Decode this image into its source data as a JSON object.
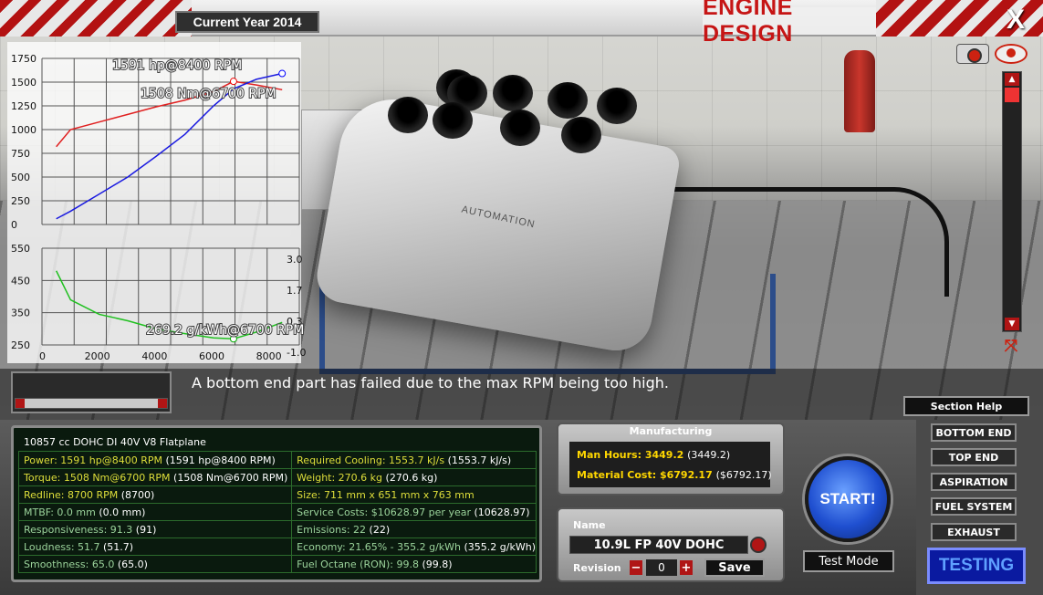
{
  "header": {
    "year_label": "Current Year 2014",
    "title": "ENGINE DESIGN",
    "close_label": "X"
  },
  "charts": {
    "power_torque": {
      "type": "line",
      "y_ticks": [
        "1750",
        "1500",
        "1250",
        "1000",
        "750",
        "500",
        "250",
        "0"
      ],
      "ylim": [
        0,
        1750
      ],
      "xlim": [
        0,
        9000
      ],
      "series": [
        {
          "color": "#e02020",
          "x": [
            500,
            1000,
            2000,
            3000,
            4000,
            5000,
            6000,
            6700,
            7500,
            8400
          ],
          "y": [
            820,
            1000,
            1080,
            1160,
            1240,
            1310,
            1400,
            1508,
            1470,
            1420
          ]
        },
        {
          "color": "#1a1ae0",
          "x": [
            500,
            1000,
            2000,
            3000,
            4000,
            5000,
            6000,
            6700,
            7500,
            8400
          ],
          "y": [
            60,
            140,
            320,
            500,
            720,
            950,
            1250,
            1430,
            1530,
            1591
          ]
        }
      ],
      "annotation_power": "1591 hp@8400 RPM",
      "annotation_torque": "1508 Nm@6700 RPM"
    },
    "economy": {
      "type": "line",
      "y_ticks_left": [
        "550",
        "450",
        "350",
        "250"
      ],
      "y_ticks_right": [
        "3.0",
        "1.7",
        "0.3",
        "-1.0"
      ],
      "x_ticks": [
        "0",
        "2000",
        "4000",
        "6000",
        "8000"
      ],
      "ylim": [
        250,
        550
      ],
      "xlim": [
        0,
        9000
      ],
      "series": [
        {
          "color": "#20c020",
          "x": [
            500,
            1000,
            2000,
            3000,
            4000,
            5000,
            6000,
            6700,
            7500,
            8400
          ],
          "y": [
            480,
            390,
            345,
            325,
            300,
            285,
            272,
            269,
            290,
            320
          ]
        }
      ],
      "annotation_economy": "269.2 g/kWh@6700 RPM"
    }
  },
  "message": "A bottom end part has failed due to the max RPM being too high.",
  "section_help_label": "Section Help",
  "stats": {
    "title": "10857 cc DOHC DI 40V V8 Flatplane",
    "rows": [
      {
        "left": "Power: 1591 hp@8400 RPM",
        "left_paren": "(1591 hp@8400 RPM)",
        "right": "Required Cooling: 1553.7 kJ/s",
        "right_paren": "(1553.7 kJ/s)"
      },
      {
        "left": "Torque: 1508 Nm@6700 RPM",
        "left_paren": "(1508 Nm@6700 RPM)",
        "right": "Weight: 270.6 kg",
        "right_paren": "(270.6 kg)"
      },
      {
        "left": "Redline: 8700 RPM",
        "left_paren": "(8700)",
        "right": "Size: 711 mm x 651 mm x 763 mm",
        "right_paren": ""
      },
      {
        "left": "MTBF: 0.0 mm",
        "left_paren": "(0.0 mm)",
        "right": "Service Costs: $10628.97 per year",
        "right_paren": "(10628.97)"
      },
      {
        "left": "Responsiveness: 91.3",
        "left_paren": "(91)",
        "right": "Emissions: 22",
        "right_paren": "(22)"
      },
      {
        "left": "Loudness: 51.7",
        "left_paren": "(51.7)",
        "right": "Economy: 21.65% - 355.2 g/kWh",
        "right_paren": "(355.2 g/kWh)"
      },
      {
        "left": "Smoothness: 65.0",
        "left_paren": "(65.0)",
        "right": "Fuel Octane (RON): 99.8",
        "right_paren": "(99.8)"
      }
    ]
  },
  "manufacturing": {
    "title": "Manufacturing",
    "man_hours_label": "Man Hours: 3449.2",
    "man_hours_paren": "(3449.2)",
    "material_cost_label": "Material Cost: $6792.17",
    "material_cost_paren": "($6792.17)"
  },
  "name_section": {
    "name_label": "Name",
    "name_value": "10.9L FP 40V DOHC",
    "revision_label": "Revision",
    "revision_value": "0",
    "minus": "−",
    "plus": "+",
    "save_label": "Save"
  },
  "actions": {
    "start_label": "START!",
    "test_mode_label": "Test Mode"
  },
  "nav": {
    "items": [
      "BOTTOM END",
      "TOP END",
      "ASPIRATION",
      "FUEL SYSTEM",
      "EXHAUST"
    ],
    "active": "TESTING"
  },
  "scene": {
    "engine_label": "AUTOMATION"
  }
}
